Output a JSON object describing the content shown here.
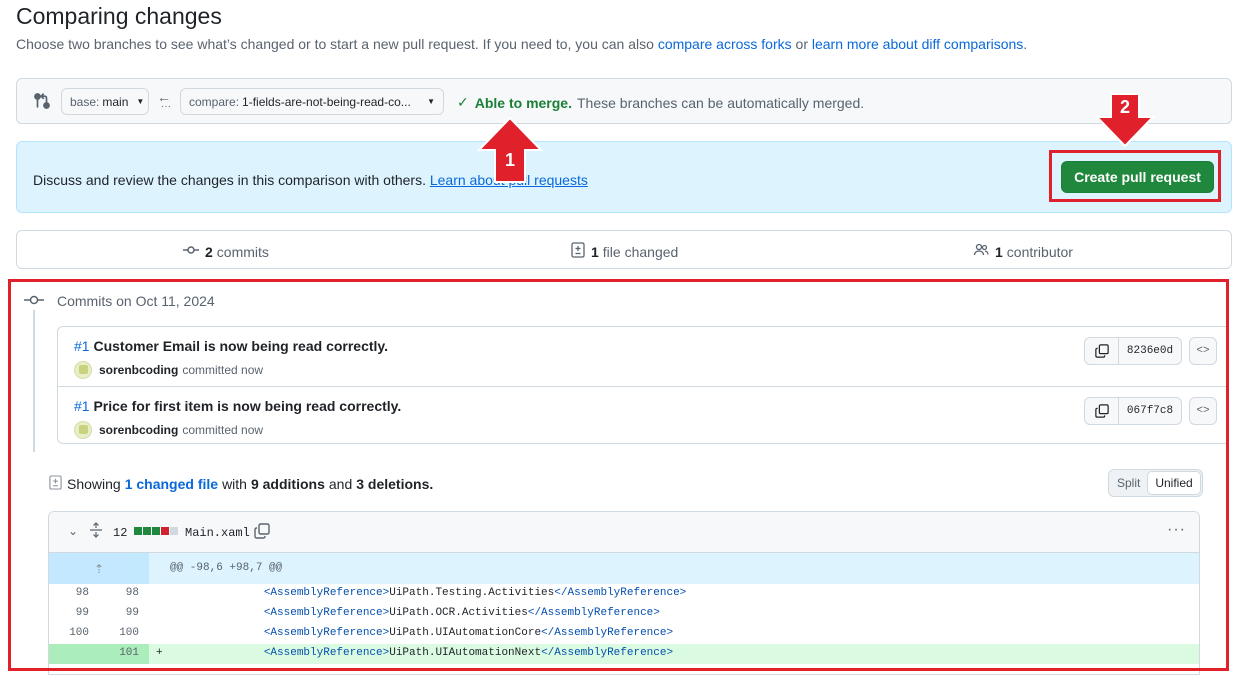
{
  "page": {
    "title": "Comparing changes",
    "subtitle_pre": "Choose two branches to see what’s changed or to start a new pull request. If you need to, you can also ",
    "subtitle_link1": "compare across forks",
    "subtitle_mid": " or ",
    "subtitle_link2": "learn more about diff comparisons",
    "subtitle_end": "."
  },
  "range": {
    "base_prefix": "base:",
    "base_value": "main",
    "compare_prefix": "compare:",
    "compare_value": "1-fields-are-not-being-read-co...",
    "merge_ok": "Able to merge.",
    "merge_text": "These branches can be automatically merged."
  },
  "banner": {
    "message": "Discuss and review the changes in this comparison with others. ",
    "link": "Learn about pull requests",
    "button": "Create pull request"
  },
  "summary": {
    "commits_count": "2",
    "commits_label": "commits",
    "files_count": "1",
    "files_label": "file changed",
    "contributors_count": "1",
    "contributors_label": "contributor"
  },
  "commits": {
    "heading": "Commits on Oct 11, 2024",
    "items": [
      {
        "ref": "#1",
        "title": "Customer Email is now being read correctly.",
        "author": "sorenbcoding",
        "action": "committed now",
        "sha": "8236e0d"
      },
      {
        "ref": "#1",
        "title": "Price for first item is now being read correctly.",
        "author": "sorenbcoding",
        "action": "committed now",
        "sha": "067f7c8"
      }
    ]
  },
  "diffstats": {
    "showing": "Showing",
    "changed_link": "1 changed file",
    "with": "with",
    "additions": "9 additions",
    "and": "and",
    "deletions": "3 deletions.",
    "split": "Split",
    "unified": "Unified"
  },
  "file": {
    "change_count": "12",
    "name": "Main.xaml",
    "hunk": "@@ -98,6 +98,7 @@",
    "lines": [
      {
        "old": "98",
        "new": "98",
        "marker": "",
        "indent": "        ",
        "open": "<AssemblyReference>",
        "text": "UiPath.Testing.Activities",
        "close": "</AssemblyReference>"
      },
      {
        "old": "99",
        "new": "99",
        "marker": "",
        "indent": "        ",
        "open": "<AssemblyReference>",
        "text": "UiPath.OCR.Activities",
        "close": "</AssemblyReference>"
      },
      {
        "old": "100",
        "new": "100",
        "marker": "",
        "indent": "        ",
        "open": "<AssemblyReference>",
        "text": "UiPath.UIAutomationCore",
        "close": "</AssemblyReference>"
      },
      {
        "old": "",
        "new": "101",
        "marker": "+",
        "indent": "        ",
        "open": "<AssemblyReference>",
        "text": "UiPath.UIAutomationNext",
        "close": "</AssemblyReference>"
      }
    ]
  },
  "annotations": {
    "label1": "1",
    "label2": "2",
    "color": "#e0202a"
  },
  "colors": {
    "accent_link": "#0969da",
    "success": "#1a7f37",
    "button_green": "#1f883d",
    "banner_bg": "#ddf4ff",
    "add_line_bg": "#dafbe1"
  }
}
